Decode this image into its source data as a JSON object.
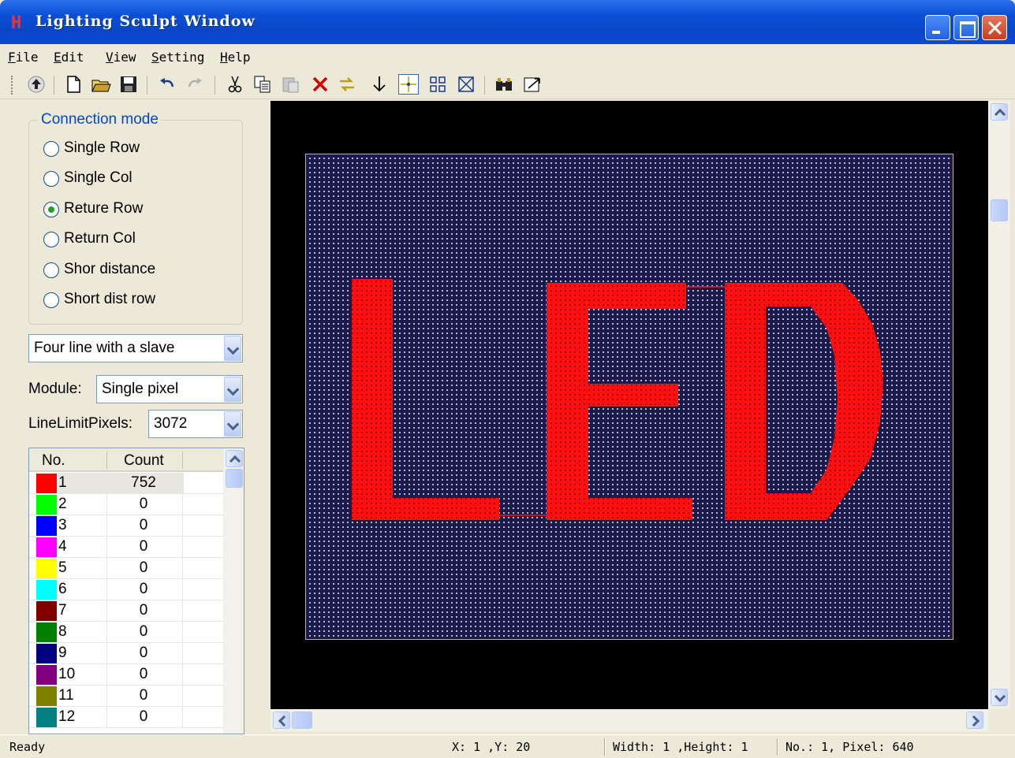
{
  "window": {
    "title": "Lighting Sculpt Window"
  },
  "menu": [
    {
      "label": "File",
      "key": "F",
      "rest": "ile"
    },
    {
      "label": "Edit",
      "key": "E",
      "rest": "dit"
    },
    {
      "label": "View",
      "key": "V",
      "rest": "iew"
    },
    {
      "label": "Setting",
      "key": "S",
      "rest": "etting"
    },
    {
      "label": "Help",
      "key": "H",
      "rest": "elp"
    }
  ],
  "toolbar": {
    "icons": [
      "up-arrow-icon",
      "new-file-icon",
      "open-folder-icon",
      "save-icon",
      "undo-icon",
      "redo-icon",
      "cut-icon",
      "copy-icon",
      "paste-icon",
      "delete-icon",
      "swap-icon",
      "move-down-icon",
      "crosshair-select-icon",
      "grid-icon",
      "cross-box-icon",
      "binoculars-icon",
      "export-icon"
    ]
  },
  "connection_mode": {
    "title": "Connection mode",
    "options": [
      {
        "label": "Single Row",
        "checked": false
      },
      {
        "label": "Single Col",
        "checked": false
      },
      {
        "label": "Reture Row",
        "checked": true
      },
      {
        "label": "Return Col",
        "checked": false
      },
      {
        "label": "Shor distance",
        "checked": false
      },
      {
        "label": "Short dist row",
        "checked": false
      }
    ]
  },
  "line_mode": {
    "value": "Four line with a slave"
  },
  "module": {
    "label": "Module:",
    "value": "Single pixel"
  },
  "line_limit": {
    "label": "LineLimitPixels:",
    "value": "3072"
  },
  "port_list": {
    "headers": [
      "No.",
      "Count"
    ],
    "rows": [
      {
        "no": "1",
        "count": "752",
        "color": "#ff0000"
      },
      {
        "no": "2",
        "count": "0",
        "color": "#00ff00"
      },
      {
        "no": "3",
        "count": "0",
        "color": "#0000ff"
      },
      {
        "no": "4",
        "count": "0",
        "color": "#ff00ff"
      },
      {
        "no": "5",
        "count": "0",
        "color": "#ffff00"
      },
      {
        "no": "6",
        "count": "0",
        "color": "#00ffff"
      },
      {
        "no": "7",
        "count": "0",
        "color": "#800000"
      },
      {
        "no": "8",
        "count": "0",
        "color": "#008000"
      },
      {
        "no": "9",
        "count": "0",
        "color": "#000080"
      },
      {
        "no": "10",
        "count": "0",
        "color": "#800080"
      },
      {
        "no": "11",
        "count": "0",
        "color": "#808000"
      },
      {
        "no": "12",
        "count": "0",
        "color": "#008080"
      }
    ]
  },
  "canvas": {
    "text": "LED",
    "led_color": "#ff1010",
    "board_color": "#1a1a4a"
  },
  "status": {
    "state": "Ready",
    "coords": "X: 1 ,Y: 20",
    "size": "Width: 1 ,Height: 1",
    "pixel": "No.: 1, Pixel: 640"
  }
}
